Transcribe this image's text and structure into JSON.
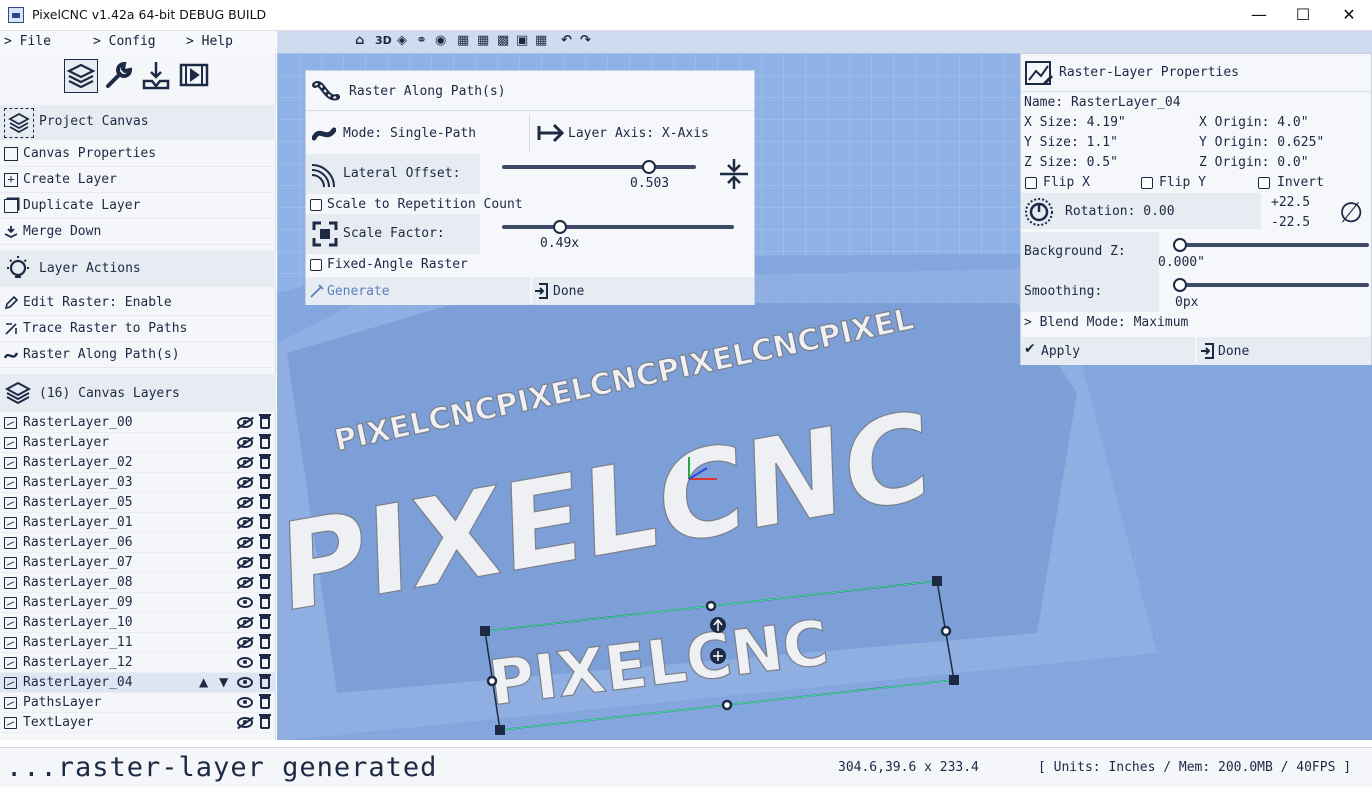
{
  "window": {
    "title": "PixelCNC v1.42a 64-bit DEBUG BUILD"
  },
  "menu": {
    "file": "> File",
    "config": "> Config",
    "help": "> Help"
  },
  "left": {
    "project_canvas": "Project Canvas",
    "canvas_actions": [
      "Canvas Properties",
      "Create Layer",
      "Duplicate Layer",
      "Merge Down"
    ],
    "layer_actions_title": "Layer Actions",
    "layer_actions": [
      "Edit Raster: Enable",
      "Trace Raster to Paths",
      "Raster Along Path(s)"
    ],
    "canvas_layers_title": "(16) Canvas Layers",
    "layers": [
      {
        "name": "RasterLayer_00",
        "visible": false
      },
      {
        "name": "RasterLayer",
        "visible": false
      },
      {
        "name": "RasterLayer_02",
        "visible": false
      },
      {
        "name": "RasterLayer_03",
        "visible": false
      },
      {
        "name": "RasterLayer_05",
        "visible": false
      },
      {
        "name": "RasterLayer_01",
        "visible": false
      },
      {
        "name": "RasterLayer_06",
        "visible": false
      },
      {
        "name": "RasterLayer_07",
        "visible": false
      },
      {
        "name": "RasterLayer_08",
        "visible": false
      },
      {
        "name": "RasterLayer_09",
        "visible": true
      },
      {
        "name": "RasterLayer_10",
        "visible": false
      },
      {
        "name": "RasterLayer_11",
        "visible": false
      },
      {
        "name": "RasterLayer_12",
        "visible": true
      },
      {
        "name": "RasterLayer_04",
        "visible": true,
        "selected": true
      },
      {
        "name": "PathsLayer",
        "visible": true
      },
      {
        "name": "TextLayer",
        "visible": false
      }
    ]
  },
  "toolbar": {
    "label_3d": "3D"
  },
  "raster_along": {
    "title": "Raster Along Path(s)",
    "mode": "Mode: Single-Path",
    "axis": "Layer Axis: X-Axis",
    "lateral_label": "Lateral Offset:",
    "lateral_value": "0.503",
    "lateral_fraction": 0.76,
    "scale_rep": "Scale to Repetition Count",
    "scale_label": "Scale Factor:",
    "scale_value": "0.49x",
    "scale_fraction": 0.25,
    "fixed_angle": "Fixed-Angle Raster",
    "generate": "Generate",
    "done": "Done"
  },
  "raster_props": {
    "title": "Raster-Layer Properties",
    "name": "Name: RasterLayer_04",
    "x_size": "X Size: 4.19\"",
    "x_origin": "X Origin: 4.0\"",
    "y_size": "Y Size: 1.1\"",
    "y_origin": "Y Origin: 0.625\"",
    "z_size": "Z Size: 0.5\"",
    "z_origin": "Z Origin: 0.0\"",
    "flip_x": "Flip X",
    "flip_y": "Flip Y",
    "invert": "Invert",
    "rotation": "Rotation: 0.00",
    "rot_plus": "+22.5",
    "rot_minus": "-22.5",
    "bg_label": "Background Z:",
    "bg_value": "0.000\"",
    "smooth_label": "Smoothing:",
    "smooth_value": "0px",
    "blend": "> Blend Mode: Maximum",
    "apply": "Apply",
    "done": "Done"
  },
  "canvas_text": {
    "top": "PIXELCNCPIXELCNCPIXELCNCPIXEL",
    "middle": "PIXELCNC",
    "bottom": "PIXELCNC"
  },
  "status": {
    "message": "...raster-layer generated",
    "coords": "304.6,39.6 x 233.4",
    "units": "[ Units: Inches / Mem: 200.0MB / 40FPS ]"
  },
  "colors": {
    "accent": "#1d2a44",
    "viewport": "#8fb2e6",
    "panel": "#f5f7fb"
  }
}
